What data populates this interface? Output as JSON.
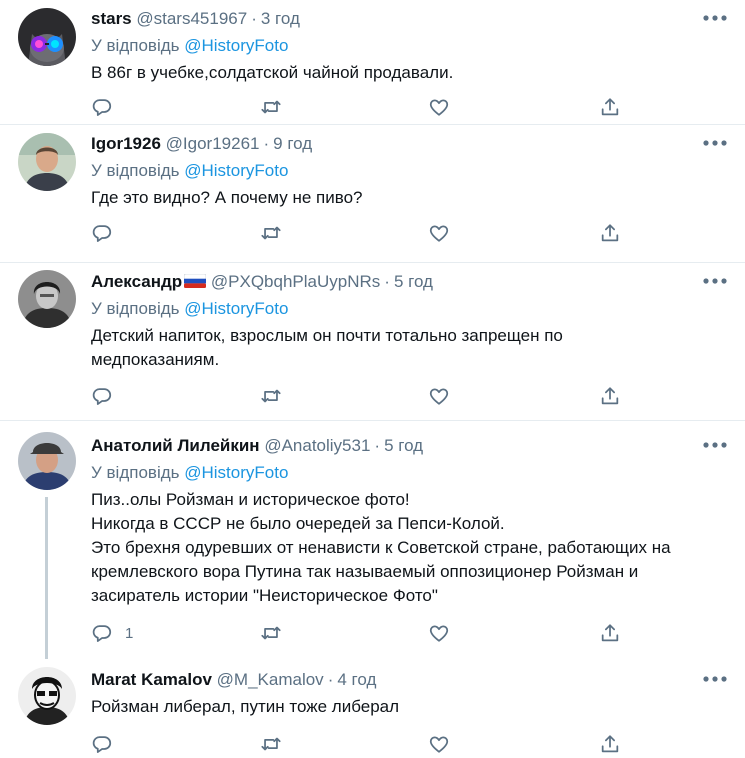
{
  "reply_prefix": "У відповідь",
  "tweets": [
    {
      "name": "stars",
      "handle": "@stars451967",
      "time": "3 год",
      "reply_to": "@HistoryFoto",
      "lines": [
        "В 86г в учебке,солдатской чайной продавали."
      ],
      "reply_count": "",
      "avatar": "cat-with-glasses"
    },
    {
      "name": "Igor1926",
      "handle": "@Igor19261",
      "time": "9 год",
      "reply_to": "@HistoryFoto",
      "lines": [
        "Где это видно? А почему не пиво?"
      ],
      "reply_count": "",
      "avatar": "man-portrait"
    },
    {
      "name": "Александр",
      "handle": "@PXQbqhPlaUypNRs",
      "time": "5 год",
      "reply_to": "@HistoryFoto",
      "lines": [
        "Детский напиток, взрослым он почти тотально запрещен по",
        "медпоказаниям."
      ],
      "reply_count": "",
      "avatar": "bw-portrait",
      "flag": "russia-flag"
    },
    {
      "name": "Анатолий Лилейкин",
      "handle": "@Anatoliy531",
      "time": "5 год",
      "reply_to": "@HistoryFoto",
      "lines": [
        "Пиз..олы Ройзман и историческое фото!",
        "Никогда в СССР не было очередей за Пепси-Колой.",
        "Это брехня одуревших от ненависти к Советской стране, работающих на",
        "кремлевского вора Путина так называемый оппозиционер Ройзман и",
        "засиратель истории \"Неисторическое Фото\""
      ],
      "reply_count": "1",
      "avatar": "man-with-cap"
    },
    {
      "name": "Marat Kamalov",
      "handle": "@M_Kamalov",
      "time": "4 год",
      "reply_to": "",
      "lines": [
        "Ройзман либерал, путин тоже либерал"
      ],
      "reply_count": "",
      "avatar": "sketch-portrait"
    }
  ],
  "colors": {
    "text": "#0f1419",
    "secondary": "#5b7083",
    "mention": "#1b95e0",
    "separator": "#e6ecf0",
    "thread_line": "#c4cfd6"
  }
}
